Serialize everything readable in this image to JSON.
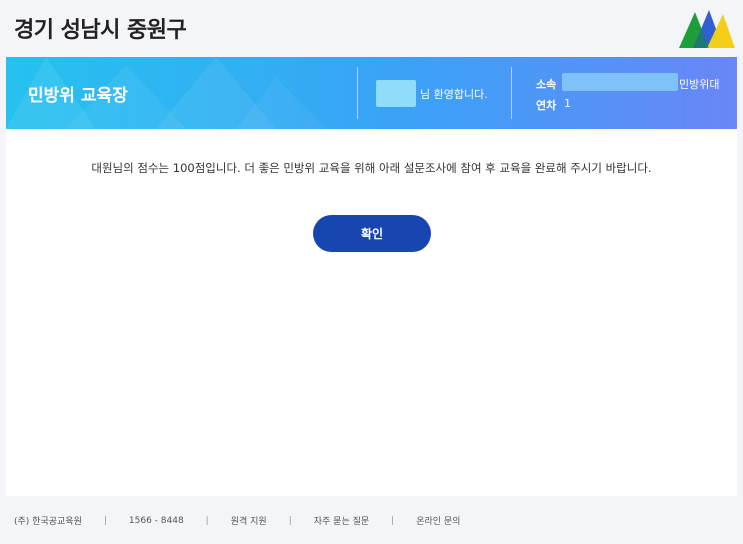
{
  "header": {
    "org_title": "경기 성남시 중원구",
    "logo_colors": [
      "#1e9e3a",
      "#2f5fd1",
      "#f3cf1a"
    ]
  },
  "banner": {
    "title": "민방위 교육장",
    "welcome_suffix": "님 환영합니다.",
    "affiliation_label": "소속",
    "affiliation_suffix": "민방위대",
    "year_label": "연차",
    "year_value": "1"
  },
  "main": {
    "message": "대원님의 점수는 100점입니다. 더 좋은 민방위 교육을 위해 아래 설문조사에 참여 후 교육을 완료해 주시기 바랍니다.",
    "confirm_label": "확인",
    "accent_color": "#1746b0"
  },
  "footer": {
    "company": "(주) 한국공교육원",
    "phone": "1566 - 8448",
    "remote_support": "원격 지원",
    "faq": "자주 묻는 질문",
    "online_inquiry": "온라인 문의",
    "separator": "|"
  }
}
